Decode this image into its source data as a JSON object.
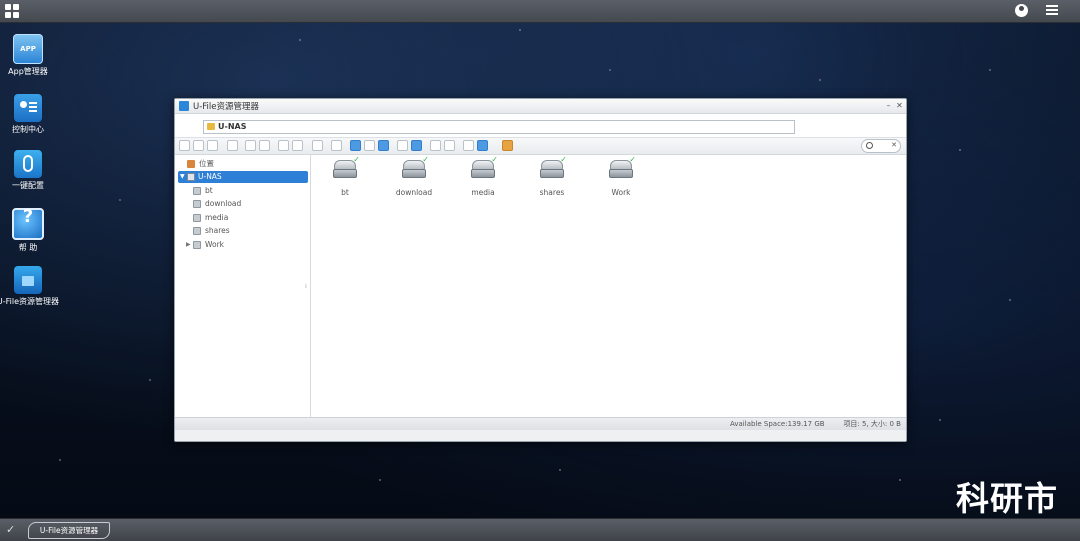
{
  "desktop": {
    "icons": [
      {
        "label": "App管理器"
      },
      {
        "label": "控制中心"
      },
      {
        "label": "一键配置"
      },
      {
        "label": "帮 助"
      },
      {
        "label": "U-File资源管理器"
      }
    ]
  },
  "window": {
    "title": "U-File资源管理器",
    "path": "U-NAS",
    "minimize_label": "–",
    "close_label": "✕",
    "search": {
      "placeholder": "",
      "clear_label": "✕"
    },
    "tree": {
      "location_label": "位置",
      "root_label": "U-NAS",
      "items": [
        "bt",
        "download",
        "media",
        "shares",
        "Work"
      ]
    },
    "files": [
      {
        "name": "bt"
      },
      {
        "name": "download"
      },
      {
        "name": "media"
      },
      {
        "name": "shares"
      },
      {
        "name": "Work"
      }
    ],
    "status": {
      "available_space": "Available Space:139.17 GB",
      "info": "项目: 5, 大小: 0 B"
    }
  },
  "taskbar": {
    "task_label": "U-File资源管理器"
  },
  "watermark": "科研市",
  "colors": {
    "selection": "#2e7fd6",
    "check": "#3bb34a"
  }
}
